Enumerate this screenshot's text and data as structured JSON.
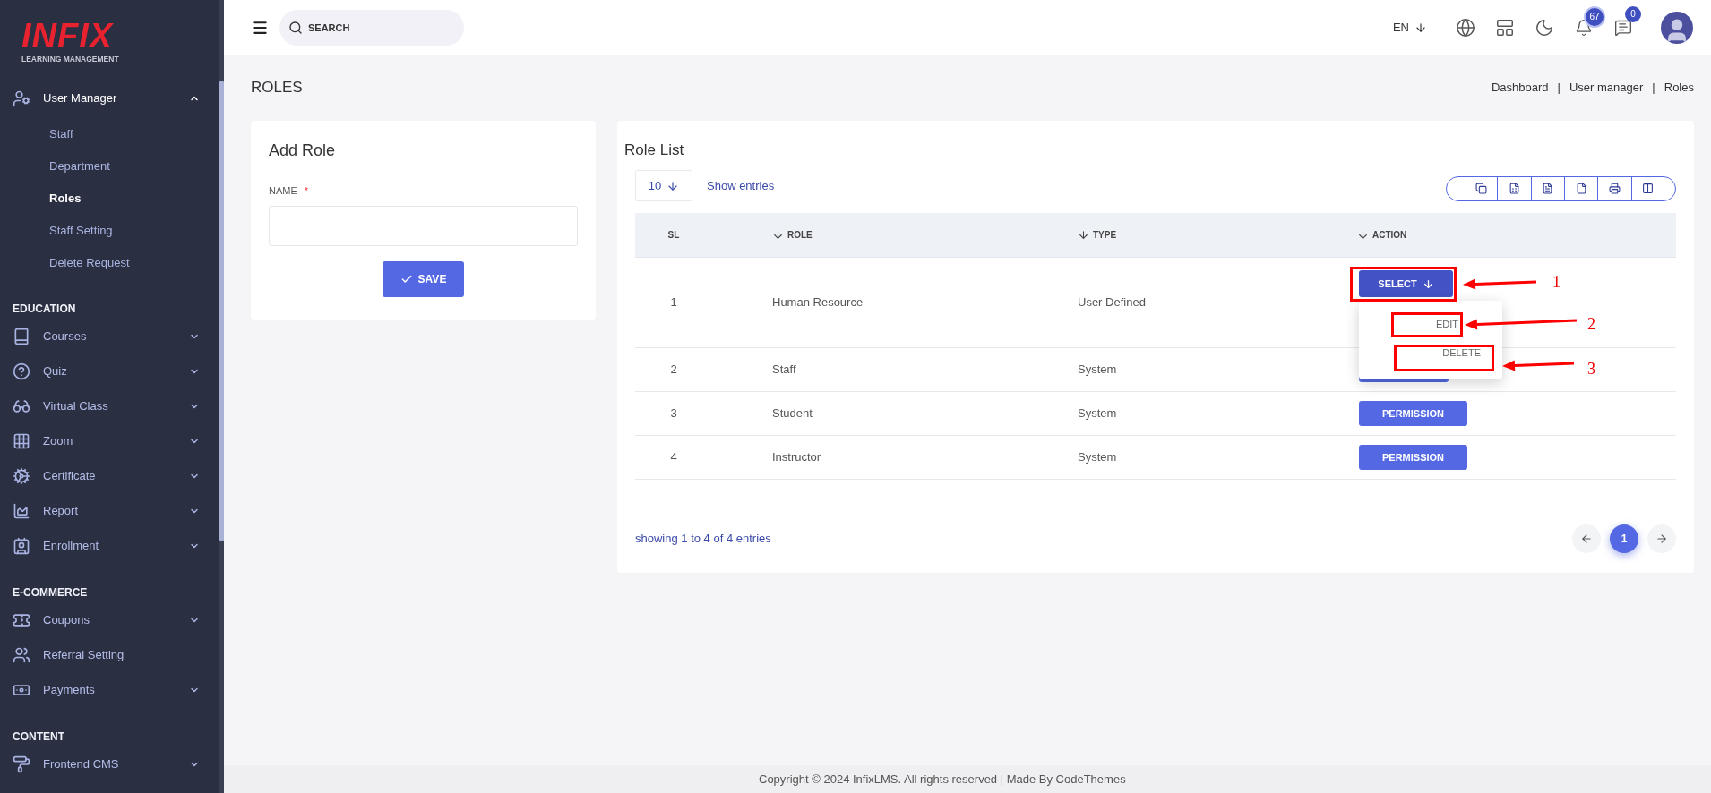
{
  "logo": {
    "wordmark": "INFIX",
    "tagline": "LEARNING MANAGEMENT"
  },
  "sidebar": {
    "sections": [
      {
        "items": [
          {
            "label": "User Manager",
            "expanded": true,
            "children": [
              {
                "label": "Staff",
                "selected": false
              },
              {
                "label": "Department",
                "selected": false
              },
              {
                "label": "Roles",
                "selected": true
              },
              {
                "label": "Staff Setting",
                "selected": false
              },
              {
                "label": "Delete Request",
                "selected": false
              }
            ]
          }
        ]
      },
      {
        "heading": "EDUCATION",
        "items": [
          {
            "label": "Courses",
            "expanded": false
          },
          {
            "label": "Quiz",
            "expanded": false
          },
          {
            "label": "Virtual Class",
            "expanded": false
          },
          {
            "label": "Zoom",
            "expanded": false
          },
          {
            "label": "Certificate",
            "expanded": false
          },
          {
            "label": "Report",
            "expanded": false
          },
          {
            "label": "Enrollment",
            "expanded": false
          }
        ]
      },
      {
        "heading": "E-COMMERCE",
        "items": [
          {
            "label": "Coupons",
            "expanded": false
          },
          {
            "label": "Referral Setting"
          },
          {
            "label": "Payments",
            "expanded": false
          }
        ]
      },
      {
        "heading": "CONTENT",
        "items": [
          {
            "label": "Frontend CMS",
            "expanded": false
          }
        ]
      }
    ]
  },
  "header": {
    "search": {
      "placeholder": "SEARCH"
    },
    "language": "EN",
    "notifications": "67",
    "messages": "0"
  },
  "page": {
    "title": "ROLES",
    "breadcrumbs": [
      "Dashboard",
      "User manager",
      "Roles"
    ],
    "separator": "|"
  },
  "add_role": {
    "title": "Add Role",
    "field": {
      "label": "NAME",
      "required": true,
      "required_mark": "*"
    },
    "save": "SAVE"
  },
  "role_list": {
    "title": "Role List",
    "page_size": "10",
    "show_entries": "Show entries",
    "columns": [
      {
        "label": "SL",
        "sortable": false
      },
      {
        "label": "ROLE",
        "sortable": true
      },
      {
        "label": "TYPE",
        "sortable": true
      },
      {
        "label": "ACTION",
        "sortable": true
      }
    ],
    "rows": [
      {
        "sl": "1",
        "role": "Human Resource",
        "type": "User Defined",
        "action": {
          "kind": "select",
          "label": "SELECT"
        }
      },
      {
        "sl": "2",
        "role": "Staff",
        "type": "System",
        "action": {
          "kind": "covered"
        }
      },
      {
        "sl": "3",
        "role": "Student",
        "type": "System",
        "action": {
          "kind": "permission",
          "label": "PERMISSION"
        }
      },
      {
        "sl": "4",
        "role": "Instructor",
        "type": "System",
        "action": {
          "kind": "permission",
          "label": "PERMISSION"
        }
      }
    ],
    "dropdown": {
      "items": [
        "EDIT",
        "DELETE"
      ]
    },
    "annotations": [
      "1",
      "2",
      "3"
    ],
    "summary": "showing 1 to 4 of 4 entries",
    "pagination": {
      "pages": [
        {
          "label": "1",
          "selected": true
        }
      ]
    }
  },
  "footer": {
    "copyright": "Copyright © 2024 InfixLMS. All rights reserved | Made By CodeThemes"
  }
}
